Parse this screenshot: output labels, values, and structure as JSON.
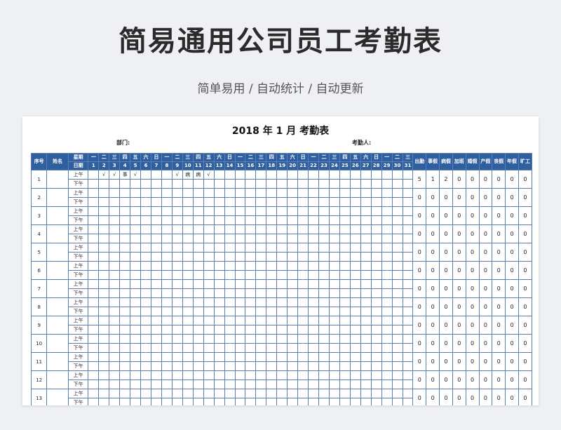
{
  "hero": {
    "title": "简易通用公司员工考勤表",
    "subtitle": "简单易用  /  自动统计  /  自动更新"
  },
  "sheet": {
    "title": "2018 年 1 月 考勤表",
    "dept_label": "部门:",
    "checker_label": "考勤人:"
  },
  "header": {
    "seq": "序号",
    "name": "姓名",
    "weekday_label": "星期",
    "date_label": "日期",
    "weekdays": [
      "一",
      "二",
      "三",
      "四",
      "五",
      "六",
      "日",
      "一",
      "二",
      "三",
      "四",
      "五",
      "六",
      "日",
      "一",
      "二",
      "三",
      "四",
      "五",
      "六",
      "日",
      "一",
      "二",
      "三",
      "四",
      "五",
      "六",
      "日",
      "一",
      "二",
      "三"
    ],
    "dates": [
      "1",
      "2",
      "3",
      "4",
      "5",
      "6",
      "7",
      "8",
      "9",
      "10",
      "11",
      "12",
      "13",
      "14",
      "15",
      "16",
      "17",
      "18",
      "19",
      "20",
      "21",
      "22",
      "23",
      "24",
      "25",
      "26",
      "27",
      "28",
      "29",
      "30",
      "31"
    ],
    "summary": [
      "出勤",
      "事假",
      "病假",
      "加班",
      "婚假",
      "产假",
      "丧假",
      "年假",
      "旷工"
    ]
  },
  "halves": {
    "am": "上午",
    "pm": "下午"
  },
  "rows": [
    {
      "seq": "1",
      "am_marks": {
        "2": "√",
        "3": "√",
        "4": "事",
        "5": "√",
        "9": "√",
        "10": "病",
        "11": "病",
        "12": "√"
      },
      "summary": [
        "5",
        "1",
        "2",
        "0",
        "0",
        "0",
        "0",
        "0",
        "0"
      ]
    },
    {
      "seq": "2",
      "am_marks": {},
      "summary": [
        "0",
        "0",
        "0",
        "0",
        "0",
        "0",
        "0",
        "0",
        "0"
      ]
    },
    {
      "seq": "3",
      "am_marks": {},
      "summary": [
        "0",
        "0",
        "0",
        "0",
        "0",
        "0",
        "0",
        "0",
        "0"
      ]
    },
    {
      "seq": "4",
      "am_marks": {},
      "summary": [
        "0",
        "0",
        "0",
        "0",
        "0",
        "0",
        "0",
        "0",
        "0"
      ]
    },
    {
      "seq": "5",
      "am_marks": {},
      "summary": [
        "0",
        "0",
        "0",
        "0",
        "0",
        "0",
        "0",
        "0",
        "0"
      ]
    },
    {
      "seq": "6",
      "am_marks": {},
      "summary": [
        "0",
        "0",
        "0",
        "0",
        "0",
        "0",
        "0",
        "0",
        "0"
      ]
    },
    {
      "seq": "7",
      "am_marks": {},
      "summary": [
        "0",
        "0",
        "0",
        "0",
        "0",
        "0",
        "0",
        "0",
        "0"
      ]
    },
    {
      "seq": "8",
      "am_marks": {},
      "summary": [
        "0",
        "0",
        "0",
        "0",
        "0",
        "0",
        "0",
        "0",
        "0"
      ]
    },
    {
      "seq": "9",
      "am_marks": {},
      "summary": [
        "0",
        "0",
        "0",
        "0",
        "0",
        "0",
        "0",
        "0",
        "0"
      ]
    },
    {
      "seq": "10",
      "am_marks": {},
      "summary": [
        "0",
        "0",
        "0",
        "0",
        "0",
        "0",
        "0",
        "0",
        "0"
      ]
    },
    {
      "seq": "11",
      "am_marks": {},
      "summary": [
        "0",
        "0",
        "0",
        "0",
        "0",
        "0",
        "0",
        "0",
        "0"
      ]
    },
    {
      "seq": "12",
      "am_marks": {},
      "summary": [
        "0",
        "0",
        "0",
        "0",
        "0",
        "0",
        "0",
        "0",
        "0"
      ]
    },
    {
      "seq": "13",
      "am_marks": {},
      "summary": [
        "0",
        "0",
        "0",
        "0",
        "0",
        "0",
        "0",
        "0",
        "0"
      ]
    }
  ],
  "colors": {
    "header_bg": "#2f5f9e",
    "grid_line": "#5a7fb5",
    "page_bg": "#eef0f4"
  }
}
